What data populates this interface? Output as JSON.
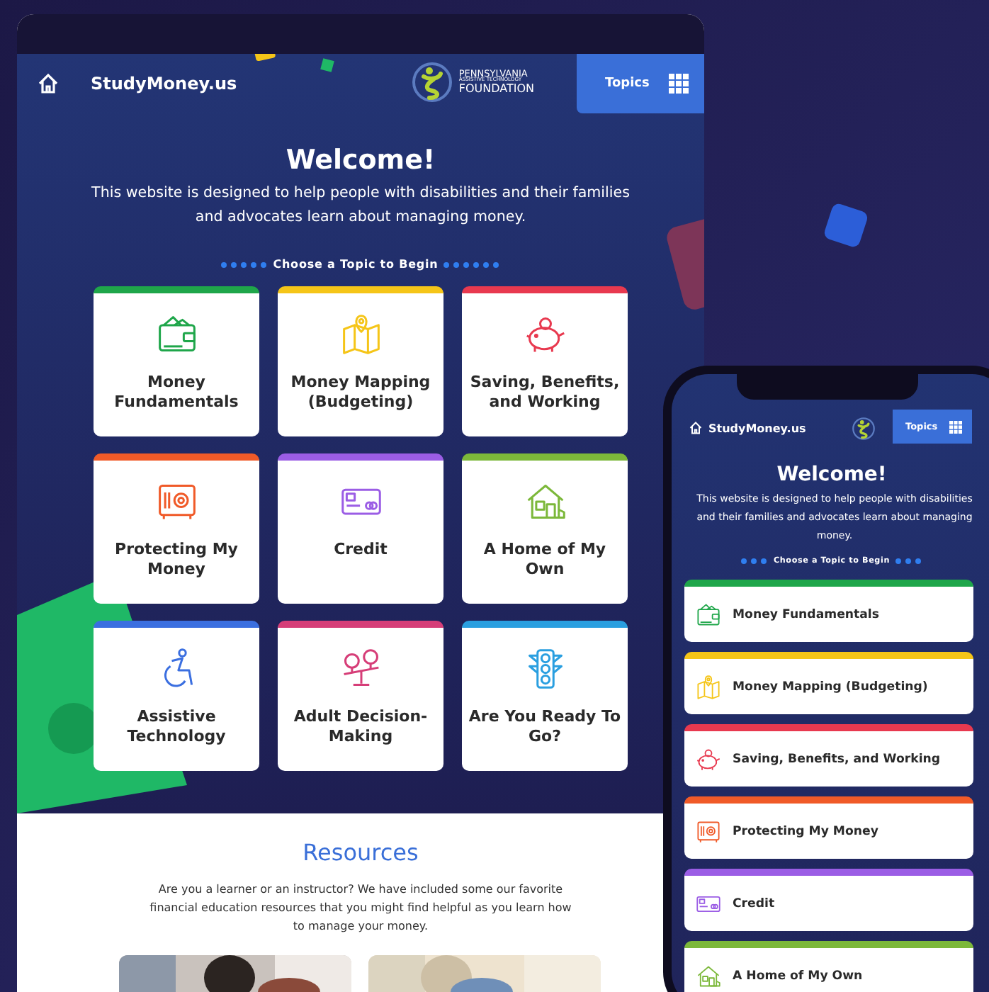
{
  "desktop": {
    "header": {
      "site_name": "StudyMoney.us",
      "logo_text": [
        "PENNSYLVANIA",
        "ASSISTIVE TECHNOLOGY",
        "FOUNDATION"
      ],
      "topics_button": "Topics"
    },
    "hero": {
      "title": "Welcome!",
      "intro": "This website is designed to help people with disabilities and their families and advocates learn about managing money.",
      "topic_prompt": "Choose a Topic to Begin"
    },
    "topics": [
      {
        "label": "Money Fundamentals",
        "color": "#1fa64a"
      },
      {
        "label": "Money Mapping (Budgeting)",
        "color": "#f5c518"
      },
      {
        "label": "Saving, Benefits, and Working",
        "color": "#e8394f"
      },
      {
        "label": "Protecting My Money",
        "color": "#f05a28"
      },
      {
        "label": "Credit",
        "color": "#9b5de5"
      },
      {
        "label": "A Home of My Own",
        "color": "#7cb83a"
      },
      {
        "label": "Assistive Technology",
        "color": "#3b6fe0"
      },
      {
        "label": "Adult Decision-Making",
        "color": "#d63e78"
      },
      {
        "label": "Are You Ready To Go?",
        "color": "#2a9fe0"
      }
    ],
    "resources": {
      "title": "Resources",
      "text": "Are you a learner or an instructor? We have included some our favorite financial education resources that you might find helpful as you learn how to manage your money."
    }
  },
  "phone": {
    "header": {
      "site_name": "StudyMoney.us",
      "topics_button": "Topics"
    },
    "hero": {
      "title": "Welcome!",
      "intro": "This website is designed to help people with disabilities and their families and advocates learn about managing money.",
      "topic_prompt": "Choose a Topic to Begin"
    },
    "topics": [
      {
        "label": "Money Fundamentals",
        "color": "#1fa64a"
      },
      {
        "label": "Money Mapping (Budgeting)",
        "color": "#f5c518"
      },
      {
        "label": "Saving, Benefits, and Working",
        "color": "#e8394f"
      },
      {
        "label": "Protecting My Money",
        "color": "#f05a28"
      },
      {
        "label": "Credit",
        "color": "#9b5de5"
      },
      {
        "label": "A Home of My Own",
        "color": "#7cb83a"
      }
    ]
  }
}
